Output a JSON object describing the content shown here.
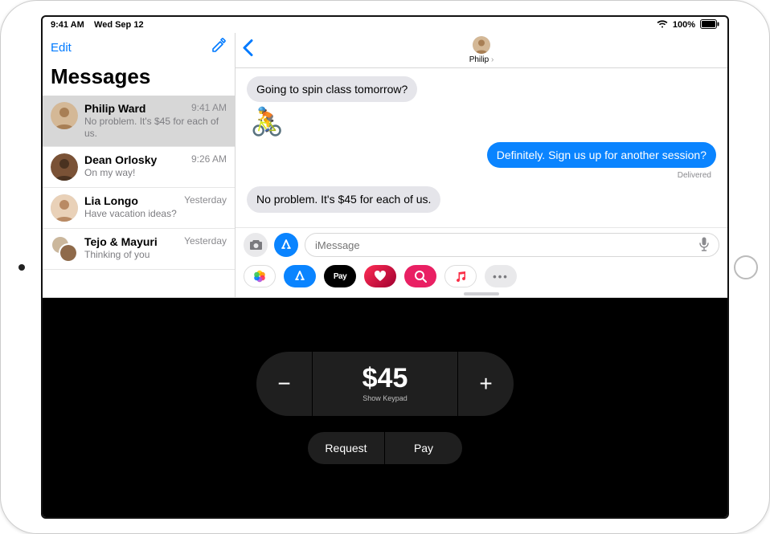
{
  "status": {
    "time": "9:41 AM",
    "date": "Wed Sep 12",
    "battery": "100%"
  },
  "sidebar": {
    "edit_label": "Edit",
    "title": "Messages"
  },
  "conversations": [
    {
      "name": "Philip Ward",
      "time": "9:41 AM",
      "preview": "No problem. It's $45 for each of us.",
      "selected": true
    },
    {
      "name": "Dean Orlosky",
      "time": "9:26 AM",
      "preview": "On my way!"
    },
    {
      "name": "Lia Longo",
      "time": "Yesterday",
      "preview": "Have vacation ideas?"
    },
    {
      "name": "Tejo & Mayuri",
      "time": "Yesterday",
      "preview": "Thinking of you",
      "double": true
    }
  ],
  "conversation": {
    "contact_name": "Philip",
    "messages": [
      {
        "dir": "in",
        "text": "Going to spin class tomorrow?"
      },
      {
        "dir": "emoji",
        "text": "🚴"
      },
      {
        "dir": "out",
        "text": "Definitely. Sign us up for another session?"
      },
      {
        "dir": "status",
        "text": "Delivered"
      },
      {
        "dir": "in",
        "text": "No problem. It's $45 for each of us."
      }
    ],
    "input_placeholder": "iMessage"
  },
  "apple_pay": {
    "amount": "$45",
    "show_keypad_label": "Show Keypad",
    "minus": "−",
    "plus": "+",
    "request_label": "Request",
    "pay_label": "Pay"
  },
  "colors": {
    "ios_blue": "#007aff",
    "imessage_blue": "#0a84ff",
    "bubble_gray": "#e5e5ea"
  }
}
